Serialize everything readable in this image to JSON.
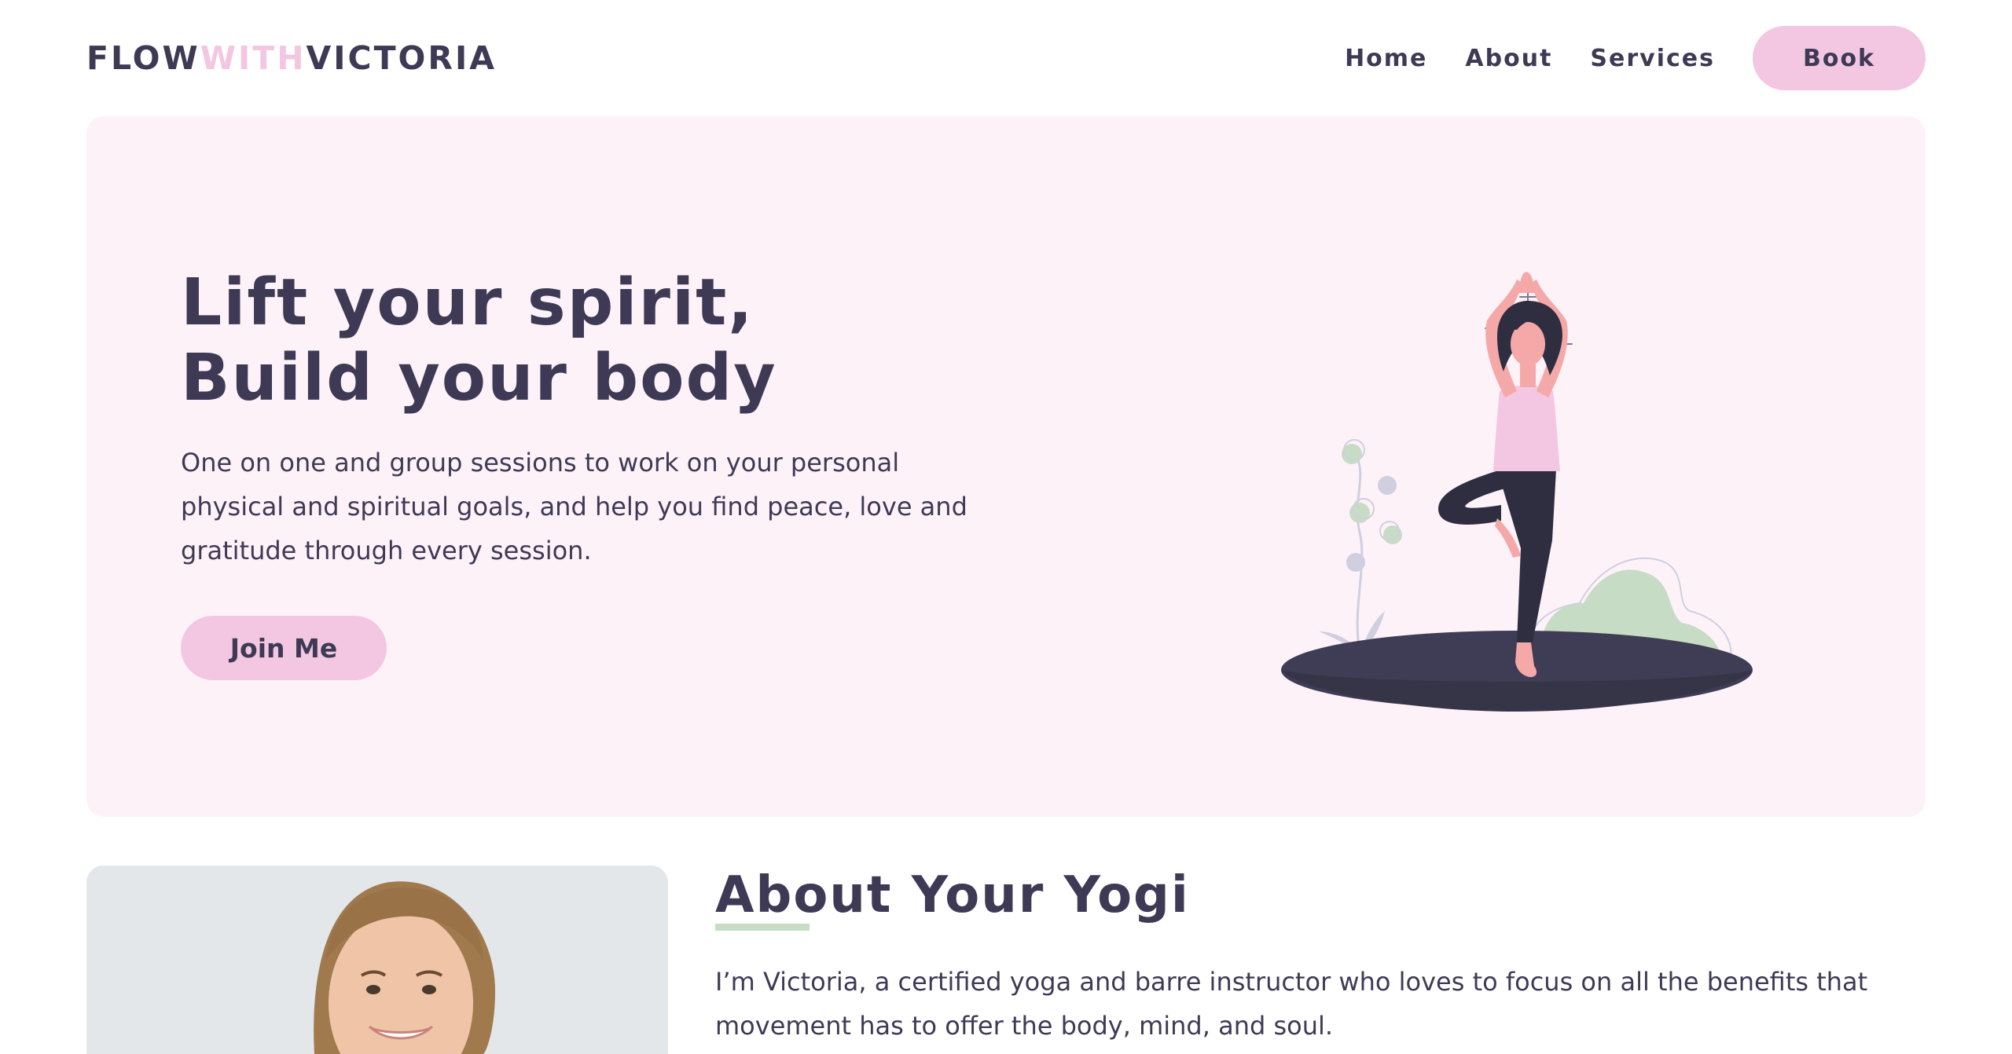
{
  "header": {
    "brand": {
      "part1": "FLOW",
      "part2": "WITH",
      "part3": "VICTORIA"
    },
    "nav": {
      "home": "Home",
      "about": "About",
      "services": "Services",
      "book": "Book"
    }
  },
  "hero": {
    "title_line1": "Lift your spirit,",
    "title_line2": "Build your body",
    "description": "One on one and group sessions to work on your personal physical and spiritual goals, and help you find peace, love and gratitude through every session.",
    "cta_label": "Join Me",
    "illustration_icon": "yoga-tree-pose-illustration"
  },
  "about": {
    "title": "About Your Yogi",
    "text": "I’m Victoria, a certified yoga and barre instructor who loves to focus on all the benefits that movement has to offer the body, mind, and soul.",
    "photo_icon": "instructor-portrait"
  },
  "colors": {
    "accent_pink": "#f3c6e1",
    "hero_background": "#fef2f9",
    "text_dark": "#3e3a55",
    "accent_green": "#c7dcc4",
    "accent_lavender": "#cfcfe0"
  }
}
